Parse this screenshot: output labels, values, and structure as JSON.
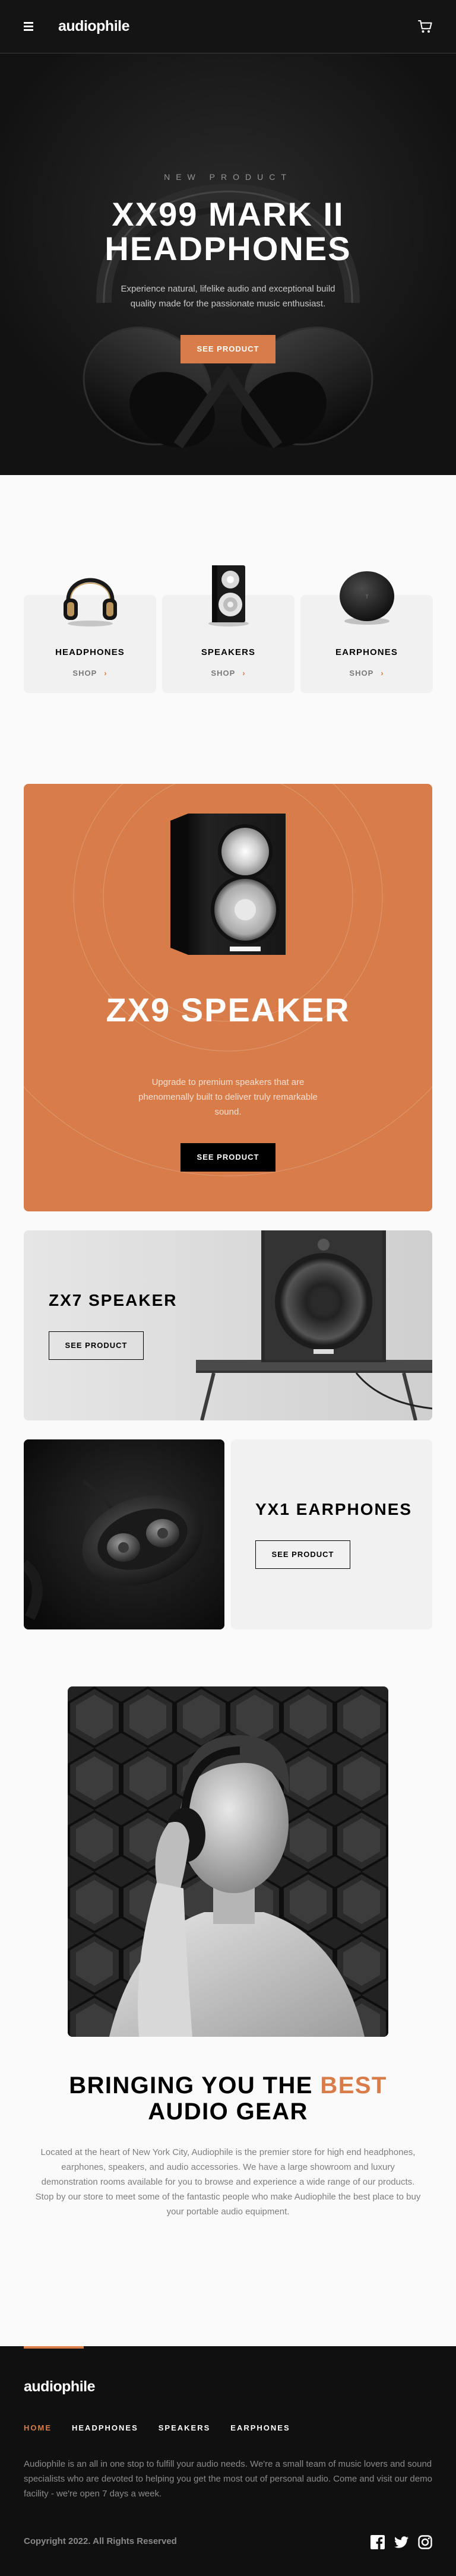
{
  "header": {
    "logo": "audiophile",
    "menu_icon": "hamburger-icon",
    "cart_icon": "cart-icon"
  },
  "hero": {
    "overline": "New Product",
    "title": "XX99 Mark II Headphones",
    "text": "Experience natural, lifelike audio and exceptional build quality made for the passionate music enthusiast.",
    "button": "See Product"
  },
  "categories": [
    {
      "title": "Headphones",
      "shop": "Shop",
      "arrow": "›"
    },
    {
      "title": "Speakers",
      "shop": "Shop",
      "arrow": "›"
    },
    {
      "title": "Earphones",
      "shop": "Shop",
      "arrow": "›"
    }
  ],
  "zx9": {
    "title": "ZX9 Speaker",
    "text": "Upgrade to premium speakers that are phenomenally built to deliver truly remarkable sound.",
    "button": "See Product"
  },
  "zx7": {
    "title": "ZX7 Speaker",
    "button": "See Product"
  },
  "yx1": {
    "title": "YX1 Earphones",
    "button": "See Product"
  },
  "about": {
    "title_part1": "Bringing you the ",
    "title_accent": "best",
    "title_part2": " audio gear",
    "text": "Located at the heart of New York City, Audiophile is the premier store for high end headphones, earphones, speakers, and audio accessories. We have a large showroom and luxury demonstration rooms available for you to browse and experience a wide range of our products. Stop by our store to meet some of the fantastic people who make Audiophile the best place to buy your portable audio equipment."
  },
  "footer": {
    "logo": "audiophile",
    "nav": [
      "Home",
      "Headphones",
      "Speakers",
      "Earphones"
    ],
    "text": "Audiophile is an all in one stop to fulfill your audio needs. We're a small team of music lovers and sound specialists who are devoted to helping you get the most out of personal audio. Come and visit our demo facility - we're open 7 days a week.",
    "copyright": "Copyright 2022. All Rights Reserved",
    "social": [
      "facebook-icon",
      "twitter-icon",
      "instagram-icon"
    ]
  },
  "colors": {
    "accent": "#D87D4A",
    "dark": "#101010",
    "light_gray": "#F1F1F1",
    "page_bg": "#FAFAFA"
  }
}
